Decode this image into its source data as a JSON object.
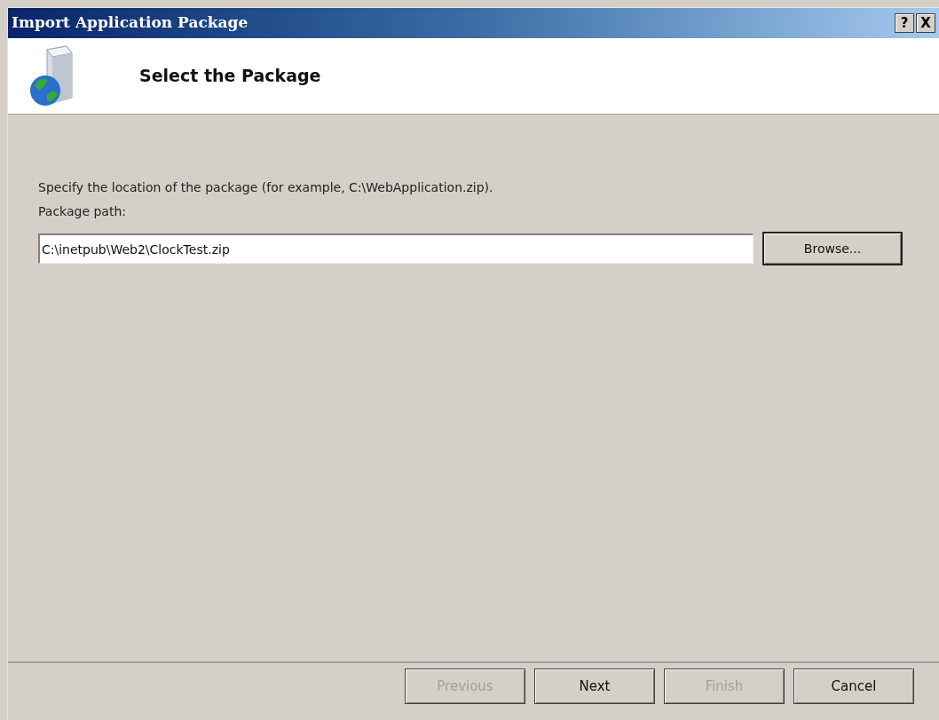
{
  "window": {
    "title": "Import Application Package",
    "title_buttons": [
      "?",
      "X"
    ]
  },
  "header": {
    "title": "Select the Package"
  },
  "instruction": "Specify the location of the package (for example, C:\\WebApplication.zip).",
  "path_field": {
    "label": "Package path:",
    "value": "C:\\inetpub\\Web2\\ClockTest.zip"
  },
  "browse_button": "Browse...",
  "buttons": [
    {
      "label": "Previous",
      "disabled": true,
      "default": false
    },
    {
      "label": "Next",
      "disabled": false,
      "default": false
    },
    {
      "label": "Finish",
      "disabled": true,
      "default": false
    },
    {
      "label": "Cancel",
      "disabled": false,
      "default": false
    }
  ]
}
